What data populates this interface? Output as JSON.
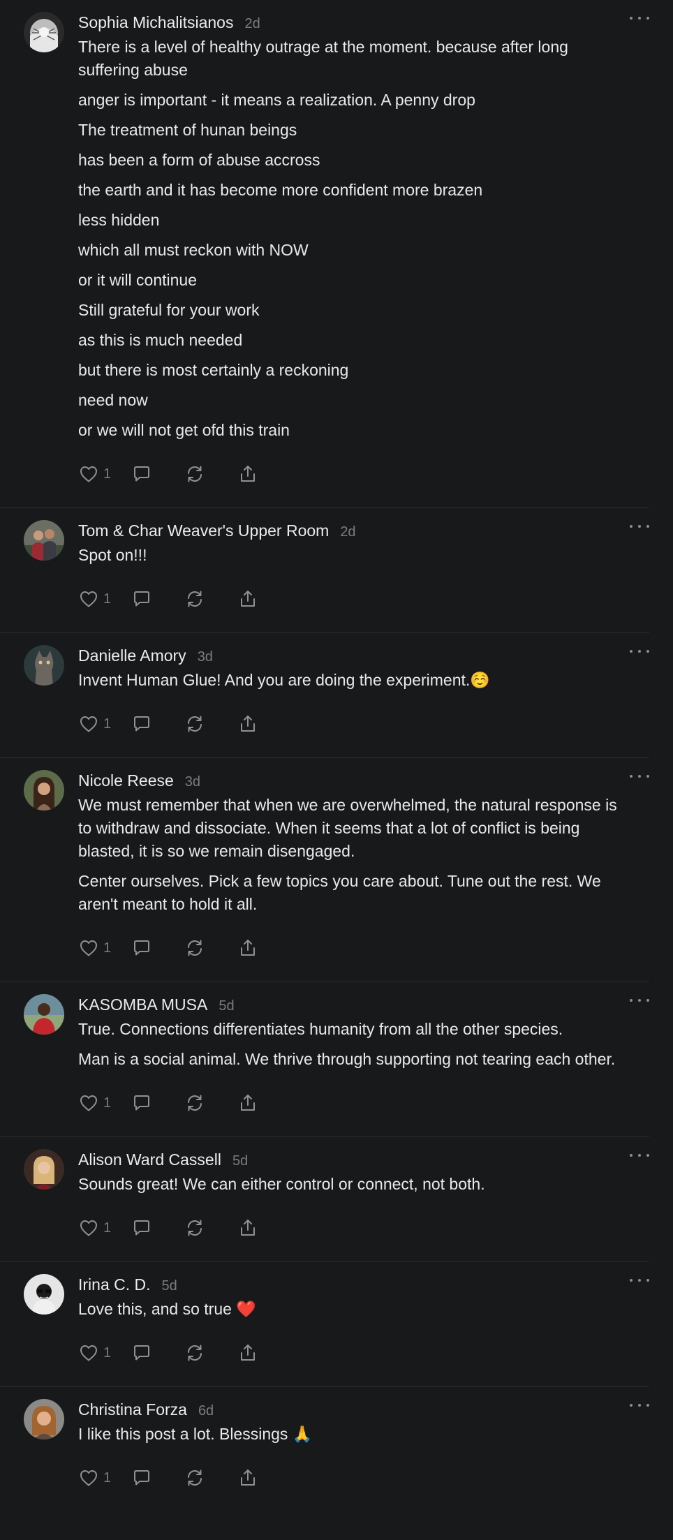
{
  "colors": {
    "background": "#18191b",
    "text": "#e9e9ea",
    "muted": "#7b7d81",
    "divider": "#2b2d30"
  },
  "icons": {
    "like": "heart-icon",
    "reply": "speech-bubble-icon",
    "restack": "refresh-arrows-icon",
    "share": "share-icon",
    "more": "ellipsis-icon"
  },
  "comments": [
    {
      "author": "Sophia Michalitsianos",
      "time": "2d",
      "likes": "1",
      "avatar": "monochrome",
      "paragraphs": [
        "There is a level of healthy outrage at the moment. because after long suffering abuse",
        "anger is important - it means a realization. A penny drop",
        "The treatment of hunan beings",
        "has been a form of abuse accross",
        "the earth and it has become more confident more brazen",
        "less hidden",
        "which all must reckon with NOW",
        "or it will continue",
        "Still grateful for your work",
        "as this is much needed",
        "but there is most certainly a reckoning",
        "need now",
        "or we will not get ofd this train"
      ]
    },
    {
      "author": "Tom & Char Weaver's Upper Room",
      "time": "2d",
      "likes": "1",
      "avatar": "couple",
      "paragraphs": [
        "Spot on!!!"
      ]
    },
    {
      "author": "Danielle Amory",
      "time": "3d",
      "likes": "1",
      "avatar": "cat",
      "paragraphs": [
        "Invent Human Glue! And you are doing the experiment.☺️"
      ]
    },
    {
      "author": "Nicole Reese",
      "time": "3d",
      "likes": "1",
      "avatar": "woman-dark-hair",
      "paragraphs": [
        "We must remember that when we are overwhelmed, the natural response is to withdraw and dissociate. When it seems that a lot of conflict is being blasted, it is so we remain disengaged.",
        "Center ourselves. Pick a few topics you care about. Tune out the rest. We aren't meant to hold it all."
      ]
    },
    {
      "author": "KASOMBA MUSA",
      "time": "5d",
      "likes": "1",
      "avatar": "man-red-shirt",
      "paragraphs": [
        "True. Connections differentiates humanity from all the other species.",
        "Man is a social animal. We thrive through supporting not tearing each other."
      ]
    },
    {
      "author": "Alison Ward Cassell",
      "time": "5d",
      "likes": "1",
      "avatar": "woman-blonde",
      "paragraphs": [
        "Sounds great! We can either control or connect, not both."
      ]
    },
    {
      "author": "Irina C. D.",
      "time": "5d",
      "likes": "1",
      "avatar": "sunglasses",
      "paragraphs": [
        "Love this, and so true ❤️"
      ]
    },
    {
      "author": "Christina Forza",
      "time": "6d",
      "likes": "1",
      "avatar": "woman-auburn",
      "paragraphs": [
        "I like this post a lot. Blessings 🙏"
      ]
    }
  ]
}
